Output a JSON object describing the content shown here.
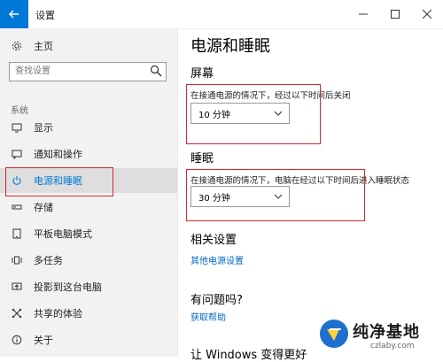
{
  "window": {
    "title": "设置"
  },
  "sidebar": {
    "home_label": "主页",
    "search_placeholder": "查找设置",
    "section_label": "系统",
    "items": [
      {
        "label": "显示",
        "icon": "monitor-icon"
      },
      {
        "label": "通知和操作",
        "icon": "message-icon"
      },
      {
        "label": "电源和睡眠",
        "icon": "power-icon",
        "selected": true
      },
      {
        "label": "存储",
        "icon": "storage-icon"
      },
      {
        "label": "平板电脑模式",
        "icon": "tablet-icon"
      },
      {
        "label": "多任务",
        "icon": "multitask-icon"
      },
      {
        "label": "投影到这台电脑",
        "icon": "project-icon"
      },
      {
        "label": "共享的体验",
        "icon": "share-icon"
      },
      {
        "label": "关于",
        "icon": "info-icon"
      }
    ]
  },
  "main": {
    "title": "电源和睡眠",
    "screen": {
      "heading": "屏幕",
      "description": "在接通电源的情况下，经过以下时间后关闭",
      "value": "10 分钟"
    },
    "sleep": {
      "heading": "睡眠",
      "description": "在接通电源的情况下，电脑在经过以下时间后进入睡眠状态",
      "value": "30 分钟"
    },
    "related": {
      "heading": "相关设置",
      "link": "其他电源设置"
    },
    "help": {
      "heading": "有问题吗?",
      "link": "获取帮助"
    },
    "partial_text": "让 Windows 变得更好"
  },
  "watermark": {
    "title": "纯净基地",
    "url": "czlaby.com"
  },
  "colors": {
    "accent": "#0078d7",
    "link": "#0067c0",
    "highlight": "#d6262c",
    "sidebar_bg": "#f2f2f2"
  }
}
